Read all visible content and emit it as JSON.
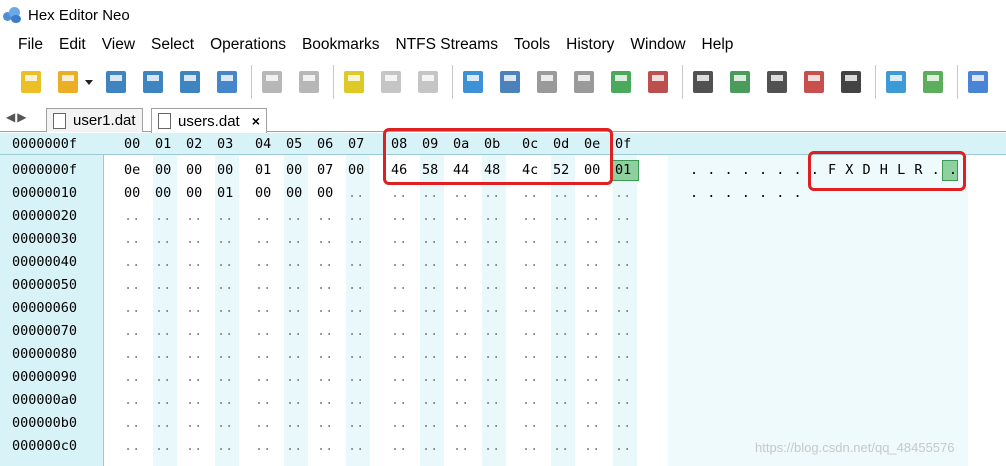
{
  "app": {
    "title": "Hex Editor Neo"
  },
  "menu": [
    "File",
    "Edit",
    "View",
    "Select",
    "Operations",
    "Bookmarks",
    "NTFS Streams",
    "Tools",
    "History",
    "Window",
    "Help"
  ],
  "tabs": [
    {
      "label": "user1.dat",
      "active": false
    },
    {
      "label": "users.dat",
      "active": true
    }
  ],
  "tab_close": "×",
  "nav_arrows": "◀▶",
  "toolbar_icons": [
    "new-file-icon",
    "open-file-icon",
    "open-dropdown-icon",
    "save-icon",
    "save-as-icon",
    "save-all-icon",
    "print-icon",
    "undo-icon",
    "redo-icon",
    "edit-icon",
    "copy-icon",
    "paste-icon",
    "jump-icon",
    "find-icon",
    "find-next-icon",
    "find-previous-icon",
    "replace-icon",
    "data-format-icon",
    "hex-mode-icon",
    "fill-icon",
    "compare-icon",
    "checksum-icon",
    "binary-icon",
    "fullscreen-icon",
    "marker-icon",
    "f1-help-icon"
  ],
  "editor": {
    "header_offset": "0000000f",
    "header_columns": [
      "00",
      "01",
      "02",
      "03",
      "04",
      "05",
      "06",
      "07",
      "08",
      "09",
      "0a",
      "0b",
      "0c",
      "0d",
      "0e",
      "0f"
    ],
    "rows": [
      {
        "address": "0000000f",
        "bytes": [
          "0e",
          "00",
          "00",
          "00",
          "01",
          "00",
          "07",
          "00",
          "46",
          "58",
          "44",
          "48",
          "4c",
          "52",
          "00",
          "01"
        ],
        "text": ". . . . . . . . F X D H L R . ."
      },
      {
        "address": "00000010",
        "bytes": [
          "00",
          "00",
          "00",
          "01",
          "00",
          "00",
          "00",
          "..",
          "..",
          "..",
          "..",
          "..",
          "..",
          "..",
          "..",
          ".."
        ],
        "text": ". . . . . . ."
      },
      {
        "address": "00000020",
        "bytes": [
          "..",
          "..",
          "..",
          "..",
          "..",
          "..",
          "..",
          "..",
          "..",
          "..",
          "..",
          "..",
          "..",
          "..",
          "..",
          ".."
        ],
        "text": ""
      },
      {
        "address": "00000030",
        "bytes": [
          "..",
          "..",
          "..",
          "..",
          "..",
          "..",
          "..",
          "..",
          "..",
          "..",
          "..",
          "..",
          "..",
          "..",
          "..",
          ".."
        ],
        "text": ""
      },
      {
        "address": "00000040",
        "bytes": [
          "..",
          "..",
          "..",
          "..",
          "..",
          "..",
          "..",
          "..",
          "..",
          "..",
          "..",
          "..",
          "..",
          "..",
          "..",
          ".."
        ],
        "text": ""
      },
      {
        "address": "00000050",
        "bytes": [
          "..",
          "..",
          "..",
          "..",
          "..",
          "..",
          "..",
          "..",
          "..",
          "..",
          "..",
          "..",
          "..",
          "..",
          "..",
          ".."
        ],
        "text": ""
      },
      {
        "address": "00000060",
        "bytes": [
          "..",
          "..",
          "..",
          "..",
          "..",
          "..",
          "..",
          "..",
          "..",
          "..",
          "..",
          "..",
          "..",
          "..",
          "..",
          ".."
        ],
        "text": ""
      },
      {
        "address": "00000070",
        "bytes": [
          "..",
          "..",
          "..",
          "..",
          "..",
          "..",
          "..",
          "..",
          "..",
          "..",
          "..",
          "..",
          "..",
          "..",
          "..",
          ".."
        ],
        "text": ""
      },
      {
        "address": "00000080",
        "bytes": [
          "..",
          "..",
          "..",
          "..",
          "..",
          "..",
          "..",
          "..",
          "..",
          "..",
          "..",
          "..",
          "..",
          "..",
          "..",
          ".."
        ],
        "text": ""
      },
      {
        "address": "00000090",
        "bytes": [
          "..",
          "..",
          "..",
          "..",
          "..",
          "..",
          "..",
          "..",
          "..",
          "..",
          "..",
          "..",
          "..",
          "..",
          "..",
          ".."
        ],
        "text": ""
      },
      {
        "address": "000000a0",
        "bytes": [
          "..",
          "..",
          "..",
          "..",
          "..",
          "..",
          "..",
          "..",
          "..",
          "..",
          "..",
          "..",
          "..",
          "..",
          "..",
          ".."
        ],
        "text": ""
      },
      {
        "address": "000000b0",
        "bytes": [
          "..",
          "..",
          "..",
          "..",
          "..",
          "..",
          "..",
          "..",
          "..",
          "..",
          "..",
          "..",
          "..",
          "..",
          "..",
          ".."
        ],
        "text": ""
      },
      {
        "address": "000000c0",
        "bytes": [
          "..",
          "..",
          "..",
          "..",
          "..",
          "..",
          "..",
          "..",
          "..",
          "..",
          "..",
          "..",
          "..",
          "..",
          "..",
          ".."
        ],
        "text": ""
      }
    ]
  },
  "colors": {
    "accent_cyan": "#d8f3f8",
    "selection_green": "#8fd19e",
    "highlight_red": "#e02020"
  },
  "watermark": "https://blog.csdn.net/qq_48455576"
}
